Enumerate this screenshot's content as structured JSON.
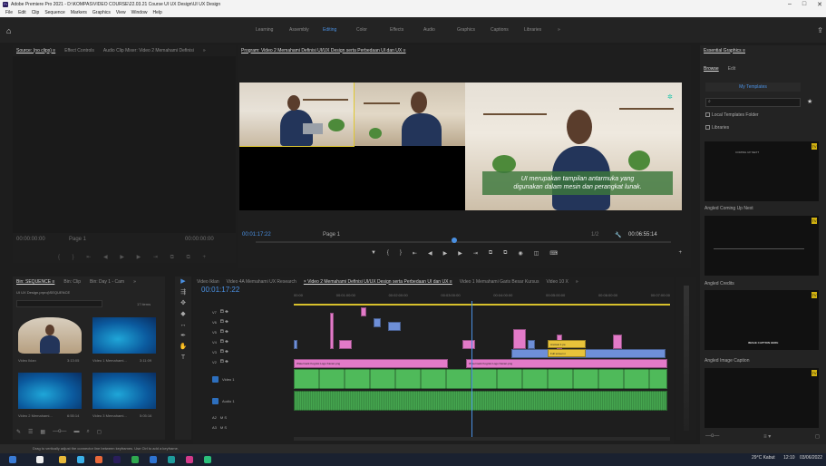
{
  "window": {
    "title": "Adobe Premiere Pro 2021 - D:\\KOMPAS\\VIDEO COURSE\\22.03.21 Course UI UX Design\\UI UX Design",
    "logo_text": "Pr",
    "minimize": "–",
    "maximize": "□",
    "close": "✕"
  },
  "menu": [
    "File",
    "Edit",
    "Clip",
    "Sequence",
    "Markers",
    "Graphics",
    "View",
    "Window",
    "Help"
  ],
  "workspaces": {
    "items": [
      "Learning",
      "Assembly",
      "Editing",
      "Color",
      "Effects",
      "Audio",
      "Graphics",
      "Captions",
      "Libraries"
    ],
    "active": "Editing",
    "more": "»"
  },
  "source_panel": {
    "tabs": [
      "Source: (no clips) ≡",
      "Effect Controls",
      "Audio Clip Mixer: Video 2 Memahami Definisi",
      "»"
    ],
    "timecode_left": "00:00:00:00",
    "timecode_right": "00:00:00:00",
    "page": "Page 1"
  },
  "program_panel": {
    "title": "Program: Video 2 Memahami Definisi UI/UX Design serta Perbedaan UI dan UX  ≡",
    "timecode": "00:01:17:22",
    "page": "Page 1",
    "fit": "1/2",
    "duration": "00:06:55:14",
    "caption_line1": "UI merupakan tampilan antarmuka yang",
    "caption_line2": "digunakan dalam mesin dan perangkat lunak."
  },
  "essential_graphics": {
    "title": "Essential Graphics  ≡",
    "tabs": [
      "Browse",
      "Edit"
    ],
    "my_templates": "My Templates",
    "local_folder": "Local Templates Folder",
    "libraries": "Libraries",
    "templates": [
      {
        "label": "Angled Coming Up Next",
        "thumb_text": "COMING UP NEXT"
      },
      {
        "label": "Angled Credits",
        "thumb_text": ""
      },
      {
        "label": "Angled Image Caption",
        "thumb_text": "IMAGE CAPTION HERE"
      },
      {
        "label": "",
        "thumb_text": ""
      }
    ],
    "badge": "TV"
  },
  "project_panel": {
    "tabs": [
      "Bin: SEQUENCE ≡",
      "Bin: Clip",
      "Bin: Day 1 - Cam",
      "»"
    ],
    "path": "UI UX Design.prproj\\SEQUENCE",
    "items_count": "17 items",
    "thumbs": [
      {
        "name": "Video Iklan",
        "duration": "3:13:05",
        "kind": "person"
      },
      {
        "name": "Video 1 Memahami...",
        "duration": "3:11:09",
        "kind": "blue"
      },
      {
        "name": "Video 2 Memahami...",
        "duration": "6:55:14",
        "kind": "blue"
      },
      {
        "name": "Video 3 Memahami...",
        "duration": "5:05:16",
        "kind": "blue"
      }
    ]
  },
  "timeline": {
    "tabs": [
      "Video Iklan",
      "Video 4A Memahami UX Research",
      "× Video 2 Memahami Definisi UI/UX Design serta Perbedaan UI dan UX ≡",
      "Video 1 Memahami Garis Besar Kursus",
      "Video 10 X",
      "»"
    ],
    "active_tab": "× Video 2 Memahami Definisi UI/UX Design serta Perbedaan UI dan UX ≡",
    "timecode": "00:01:17:22",
    "ruler": [
      "00:00",
      "00:01:00:00",
      "00:02:00:00",
      "00:03:00:00",
      "00:04:00:00",
      "00:05:00:00",
      "00:06:00:00",
      "00:07:00:00"
    ],
    "video_tracks": [
      "V7",
      "V6",
      "V5",
      "V4",
      "V3",
      "V2",
      "V1"
    ],
    "audio_tracks": [
      "A1",
      "A2",
      "A3"
    ],
    "v1_label": "Video 1",
    "a1_label": "Audio 1",
    "watermark_text": "Watermark Kognisi Logo Kanan.png",
    "yellow_clip_1": "Anotasi 1 pe",
    "yellow_clip_2": "Full screen n"
  },
  "status": {
    "hint": "Drag to vertically adjust the connector line between keyframes. Use Ctrl to add a keyframe."
  },
  "taskbar": {
    "weather": "29°C  Kabut",
    "time": "12:10",
    "date": "03/06/2022"
  },
  "colors": {
    "accent": "#4a90e2",
    "clip_pink": "#e27ac8",
    "clip_blue": "#6e8fd8",
    "clip_yellow": "#e8c33a",
    "clip_green": "#4fba5a"
  }
}
